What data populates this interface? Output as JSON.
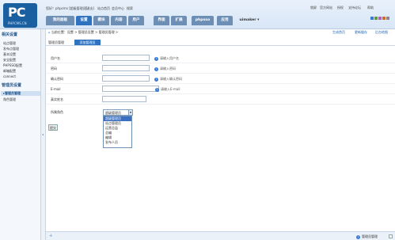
{
  "header": {
    "logo_mark": "PC",
    "logo_text": "PHPCMS.CN",
    "topline": {
      "welcome": "您好！phpcms [超级管理员]",
      "logout": "[退出]",
      "site_home": "站点首页",
      "member": "会员中心",
      "search": "搜索"
    },
    "nav": [
      "我的面板",
      "设置",
      "模块",
      "内容",
      "用户",
      "界面",
      "扩展",
      "phpsso",
      "应用",
      "uimaker ▾"
    ],
    "utils": [
      "锁屏",
      "官方网站",
      "授权",
      "支持论坛",
      "帮助"
    ]
  },
  "sidebar": {
    "section1_title": "相关设置",
    "section1_items": [
      "站点管理",
      "发布点管理",
      "基本设置",
      "安全配置",
      "PHPSSO配置",
      "邮箱配置",
      "connect"
    ],
    "section2_title": "管理员设置",
    "section2_items": [
      "管理员管理",
      "角色管理"
    ]
  },
  "main": {
    "breadcrumb": "当前位置：设置 > 管理员设置 > 管理员管理 >",
    "right_links": [
      "生成首页",
      "更新缓存",
      "后台地图"
    ],
    "tabs": [
      "管理员管理",
      "添加管理员"
    ],
    "form": {
      "fields": [
        {
          "label": "用户名",
          "hint": "请输入用户名"
        },
        {
          "label": "密码",
          "hint": "请输入密码"
        },
        {
          "label": "确认密码",
          "hint": "请输入确认密码"
        },
        {
          "label": "E-mail",
          "hint": "请输入E-mail"
        },
        {
          "label": "真实姓名",
          "hint": ""
        }
      ],
      "role_label": "所属角色",
      "role_selected": "超级管理员",
      "role_options": [
        "超级管理员",
        "站点管理员",
        "运营总监",
        "总编",
        "编辑",
        "发布人员"
      ],
      "submit": "提交"
    }
  },
  "footer": {
    "status": "管理员管理"
  }
}
